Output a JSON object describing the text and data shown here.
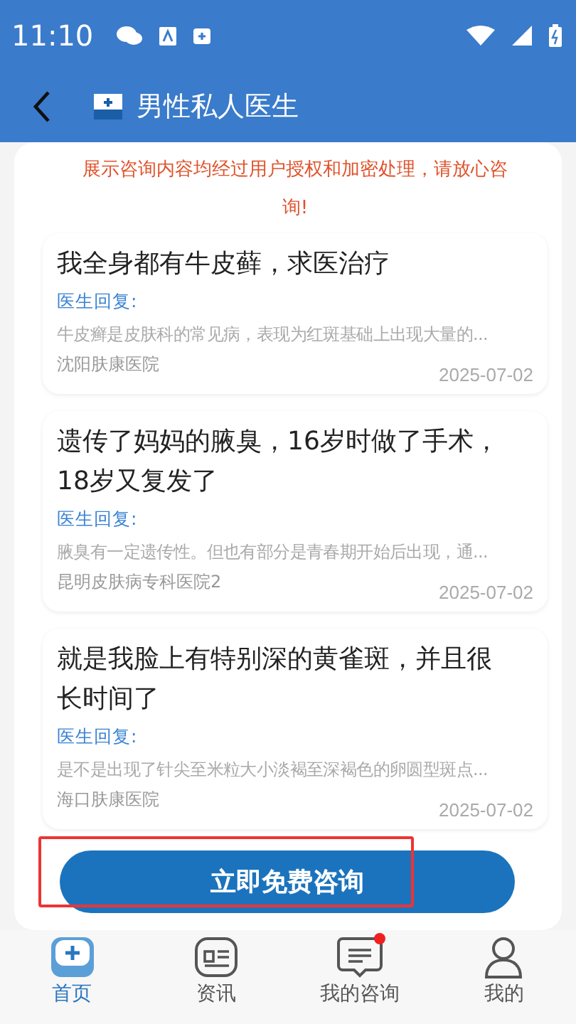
{
  "status_bar": {
    "time": "11:10"
  },
  "header": {
    "title": "男性私人医生"
  },
  "notice": "展示咨询内容均经过用户授权和加密处理，请放心咨询!",
  "consultations": [
    {
      "title": "我全身都有牛皮藓，求医治疗",
      "reply_label": "医生回复:",
      "reply": "牛皮癣是皮肤科的常见病，表现为红斑基础上出现大量的...",
      "hospital": "沈阳肤康医院",
      "date": "2025-07-02"
    },
    {
      "title": "遗传了妈妈的腋臭，16岁时做了手术，18岁又复发了",
      "reply_label": "医生回复:",
      "reply": "腋臭有一定遗传性。但也有部分是青春期开始后出现，通...",
      "hospital": "昆明皮肤病专科医院2",
      "date": "2025-07-02"
    },
    {
      "title": "就是我脸上有特别深的黄雀斑，并且很长时间了",
      "reply_label": "医生回复:",
      "reply": "是不是出现了针尖至米粒大小淡褐至深褐色的卵圆型斑点...",
      "hospital": "海口肤康医院",
      "date": "2025-07-02"
    }
  ],
  "cta_button": "立即免费咨询",
  "tabs": [
    {
      "kind": "home",
      "label": "首页",
      "selected": true,
      "badge": false
    },
    {
      "kind": "news",
      "label": "资讯",
      "selected": false,
      "badge": false
    },
    {
      "kind": "chat",
      "label": "我的咨询",
      "selected": false,
      "badge": true
    },
    {
      "kind": "user",
      "label": "我的",
      "selected": false,
      "badge": false
    }
  ]
}
